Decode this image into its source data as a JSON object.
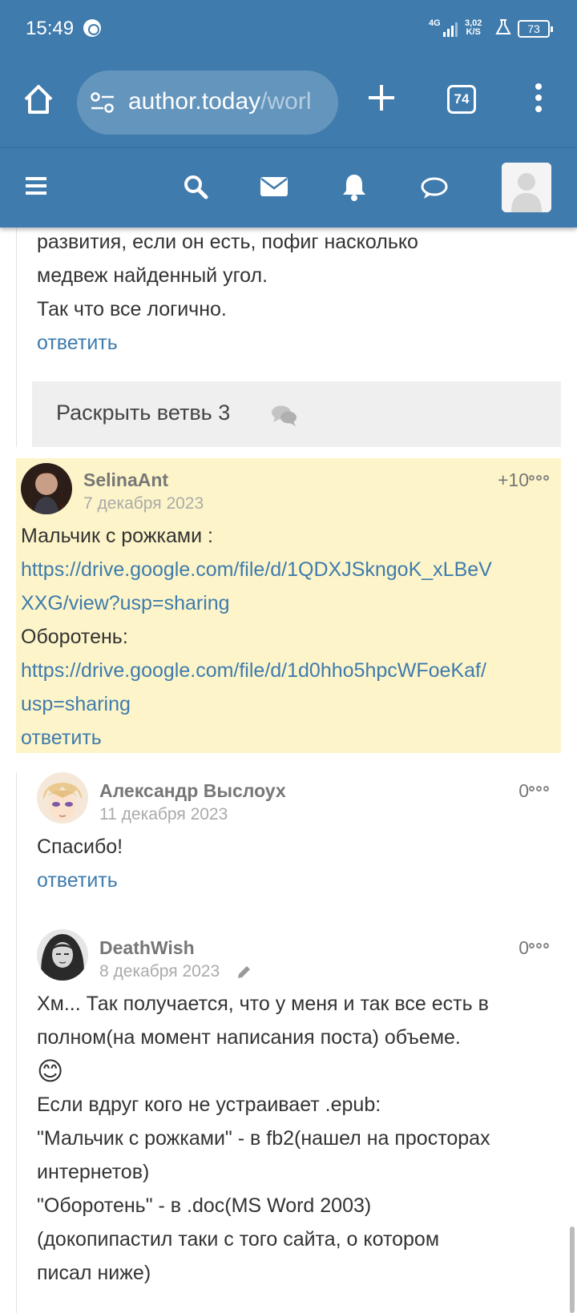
{
  "status_bar": {
    "time": "15:49",
    "network": "4G",
    "speed_value": "3,02",
    "speed_unit": "K/S",
    "battery": "73"
  },
  "browser": {
    "url_host": "author.today",
    "url_path": "/worl",
    "tab_count": "74"
  },
  "prev_comment": {
    "lines": [
      "развития, если он есть, пофиг насколько",
      "медвеж найденный угол.",
      "Так что все логично."
    ],
    "reply": "ответить"
  },
  "expand_branch": {
    "label": "Раскрыть ветвь 3"
  },
  "comments": [
    {
      "author": "SelinaAnt",
      "date": "7 декабря 2023",
      "score": "+10",
      "highlighted": true,
      "line1": "Мальчик с рожками :",
      "link1a": " https://drive.google.com/file/d/1QDXJSkngoK_xLBeV",
      "link1b": "XXG/view?usp=sharing",
      "line2": "Оборотень:",
      "link2a": "https://drive.google.com/file/d/1d0hho5hpcWFoeKaf/",
      "link2b": "usp=sharing",
      "reply": "ответить"
    },
    {
      "author": "Александр Выслоух",
      "date": "11 декабря 2023",
      "score": "0",
      "text": "Спасибо!",
      "reply": "ответить"
    },
    {
      "author": "DeathWish",
      "date": "8 декабря 2023",
      "score": "0",
      "edited": true,
      "lines": [
        "Хм... Так получается, что у меня и так все есть в",
        "полном(на момент написания поста) объеме.",
        "😊",
        "Если вдруг кого не устраивает .epub:",
        "\"Мальчик с рожками\" - в fb2(нашел на просторах",
        "интернетов)",
        "\"Оборотень\" - в .doc(MS Word 2003)",
        "(докопипастил таки с того сайта, о котором",
        "писал ниже)"
      ]
    }
  ],
  "colors": {
    "header": "#3f7bad",
    "link": "#3f7bad",
    "highlight": "#fdf5c9"
  }
}
